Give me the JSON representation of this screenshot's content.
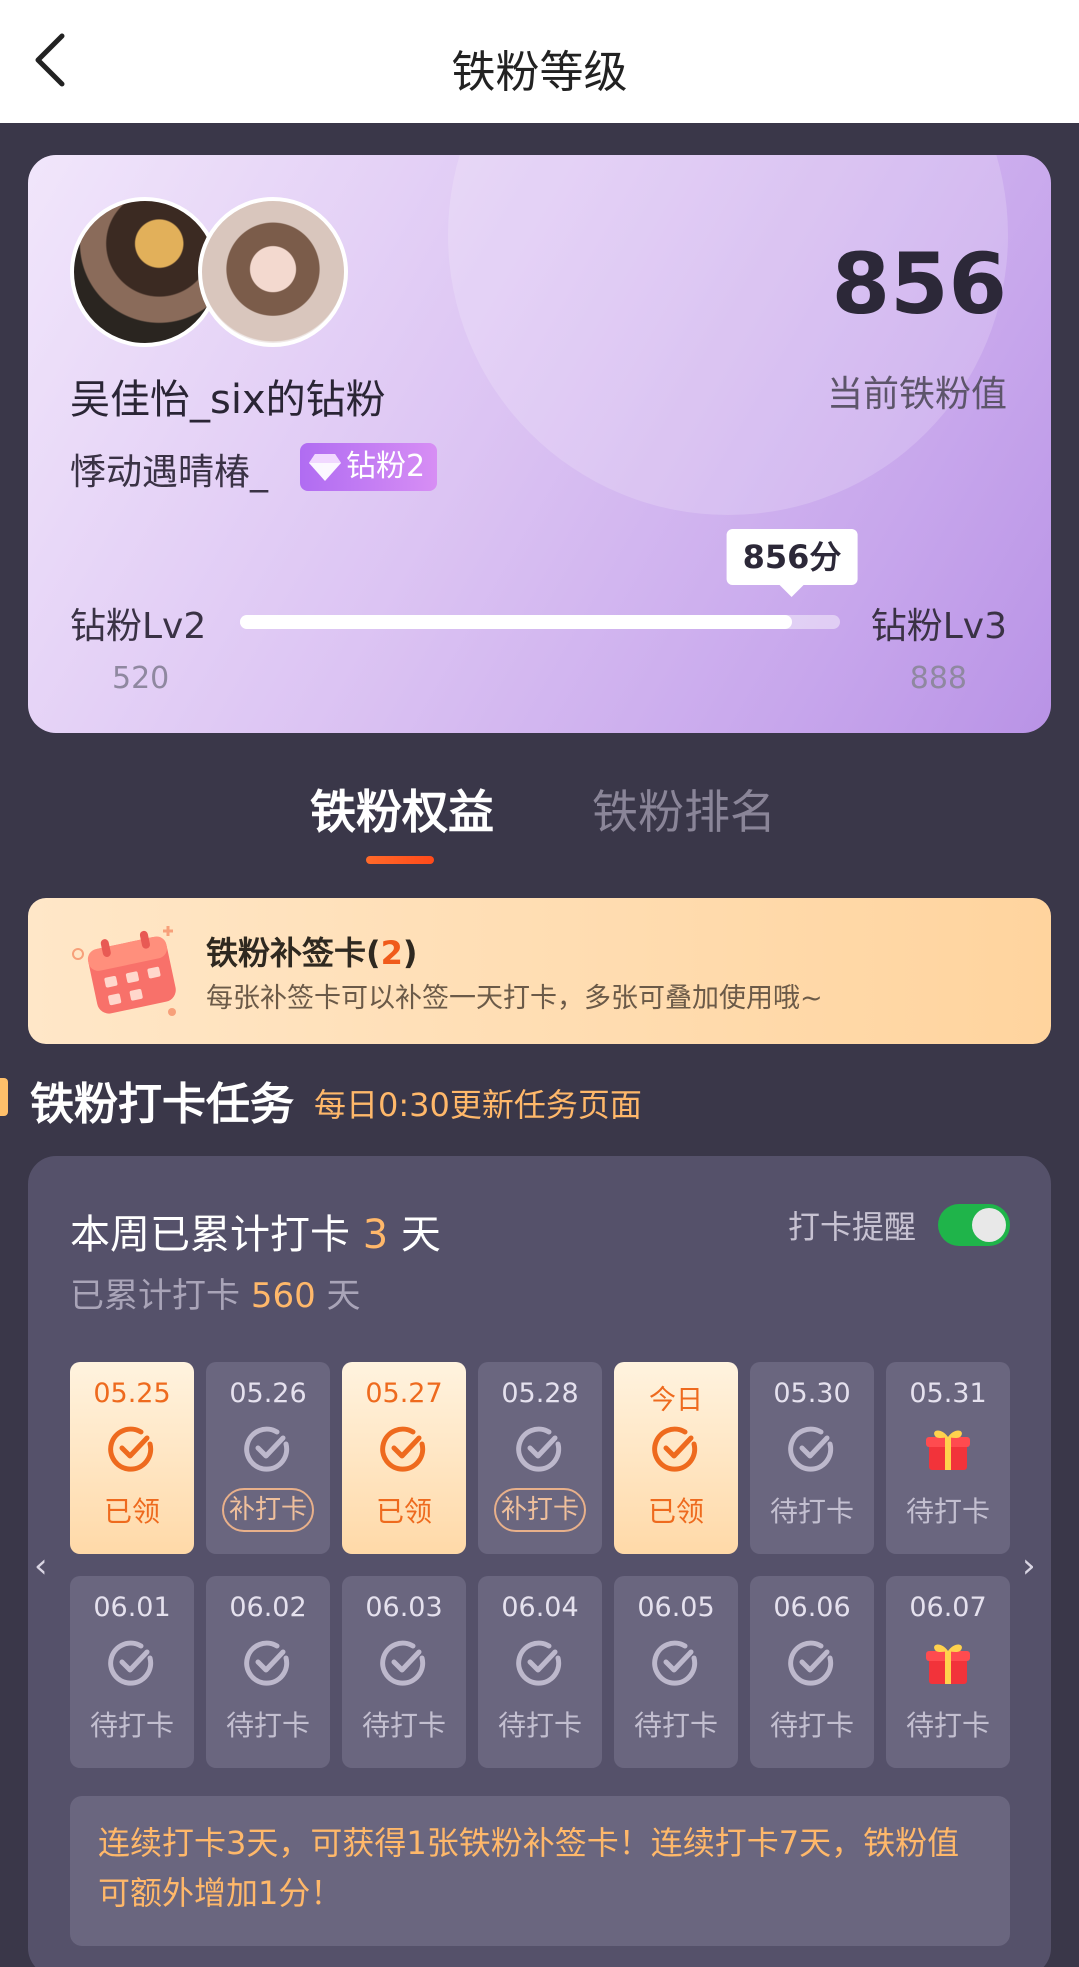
{
  "header": {
    "title": "铁粉等级"
  },
  "profile": {
    "name": "吴佳怡_six的钻粉",
    "subname": "悸动遇晴椿_",
    "badge": "钻粉2",
    "score": "856",
    "score_label": "当前铁粉值",
    "level_left": "钻粉Lv2",
    "level_right": "钻粉Lv3",
    "level_left_value": "520",
    "level_right_value": "888",
    "progress_tip": "856分",
    "progress_fraction": 0.92
  },
  "tabs": [
    {
      "label": "铁粉权益",
      "active": true
    },
    {
      "label": "铁粉排名",
      "active": false
    }
  ],
  "banner": {
    "title_prefix": "铁粉补签卡(",
    "count": "2",
    "title_suffix": ")",
    "desc": "每张补签卡可以补签一天打卡，多张可叠加使用哦~"
  },
  "section": {
    "title": "铁粉打卡任务",
    "subtitle": "每日0:30更新任务页面"
  },
  "checkin": {
    "week_prefix": "本周已累计打卡 ",
    "week_count": "3",
    "week_suffix": " 天",
    "total_prefix": "已累计打卡 ",
    "total_count": "560",
    "total_suffix": " 天",
    "remind_label": "打卡提醒",
    "remind_on": true,
    "days": [
      {
        "date": "05.25",
        "status": "已领",
        "state": "done",
        "icon": "check-icon"
      },
      {
        "date": "05.26",
        "status": "补打卡",
        "state": "makeup",
        "icon": "check-icon"
      },
      {
        "date": "05.27",
        "status": "已领",
        "state": "done",
        "icon": "check-icon"
      },
      {
        "date": "05.28",
        "status": "补打卡",
        "state": "makeup",
        "icon": "check-icon"
      },
      {
        "date": "今日",
        "status": "已领",
        "state": "done",
        "icon": "check-icon"
      },
      {
        "date": "05.30",
        "status": "待打卡",
        "state": "pending",
        "icon": "check-icon"
      },
      {
        "date": "05.31",
        "status": "待打卡",
        "state": "pending",
        "icon": "gift-icon"
      },
      {
        "date": "06.01",
        "status": "待打卡",
        "state": "pending",
        "icon": "check-icon"
      },
      {
        "date": "06.02",
        "status": "待打卡",
        "state": "pending",
        "icon": "check-icon"
      },
      {
        "date": "06.03",
        "status": "待打卡",
        "state": "pending",
        "icon": "check-icon"
      },
      {
        "date": "06.04",
        "status": "待打卡",
        "state": "pending",
        "icon": "check-icon"
      },
      {
        "date": "06.05",
        "status": "待打卡",
        "state": "pending",
        "icon": "check-icon"
      },
      {
        "date": "06.06",
        "status": "待打卡",
        "state": "pending",
        "icon": "check-icon"
      },
      {
        "date": "06.07",
        "status": "待打卡",
        "state": "pending",
        "icon": "gift-icon"
      }
    ],
    "note": "连续打卡3天，可获得1张铁粉补签卡！连续打卡7天，铁粉值可额外增加1分！"
  },
  "colors": {
    "accent_orange": "#ee6a1e",
    "highlight": "#ffb86a",
    "toggle_on": "#1fb44a",
    "panel_bg": "#55516a",
    "page_bg": "#3a3749"
  }
}
